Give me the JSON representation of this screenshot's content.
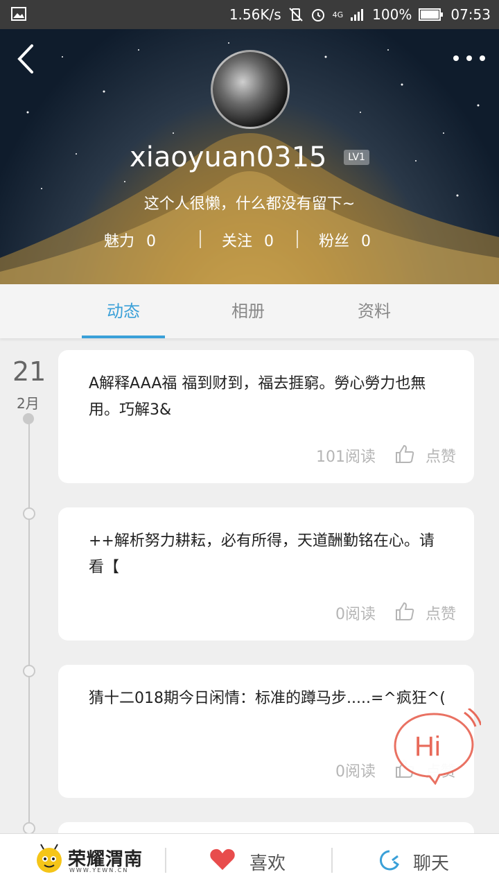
{
  "status_bar": {
    "speed": "1.56K/s",
    "network": "4G",
    "battery": "100%",
    "time": "07:53"
  },
  "profile": {
    "username": "xiaoyuan0315",
    "level": "LV1",
    "bio": "这个人很懒，什么都没有留下~",
    "stats": [
      {
        "label": "魅力",
        "value": "0"
      },
      {
        "label": "关注",
        "value": "0"
      },
      {
        "label": "粉丝",
        "value": "0"
      }
    ]
  },
  "tabs": [
    {
      "label": "动态",
      "active": true
    },
    {
      "label": "相册",
      "active": false
    },
    {
      "label": "资料",
      "active": false
    }
  ],
  "timeline": {
    "day": "21",
    "month": "2月",
    "posts": [
      {
        "text": "A解释AAA福 福到财到，福去捱窮。勞心勞力也無用。巧解3&",
        "reads": "101阅读",
        "like_label": "点赞"
      },
      {
        "text": "++解析努力耕耘，必有所得，天道酬勤铭在心。请看【",
        "reads": "0阅读",
        "like_label": "点赞"
      },
      {
        "text": "猜十二018期今日闲情：标准的蹲马步.....=^疯狂^(",
        "reads": "0阅读",
        "like_label": "点赞"
      }
    ]
  },
  "hi_bubble": {
    "label": "Hi",
    "color": "#e86a5a"
  },
  "bottom_bar": {
    "logo_text": "荣耀渭南",
    "logo_url": "WWW.YEWN.CN",
    "like_label": "喜欢",
    "chat_label": "聊天",
    "like_color": "#e84c4c",
    "chat_color": "#3aa0d8"
  },
  "accent_color": "#3aa0d8"
}
